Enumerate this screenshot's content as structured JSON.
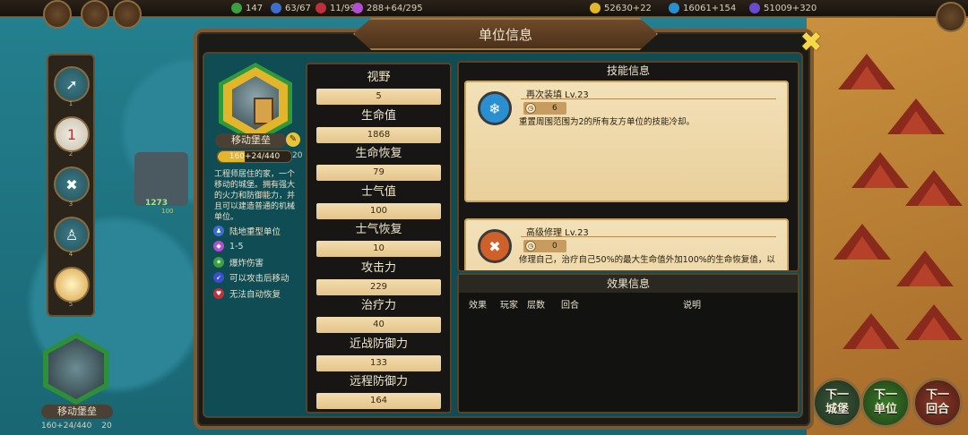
{
  "topbar": {
    "res1": "147",
    "res2": "63/67",
    "res3": "11/99",
    "res4": "288+64/295",
    "gold": "52630+22",
    "res6": "16061+154",
    "res7": "51009+320"
  },
  "leftstrip": {
    "numbers": [
      "1",
      "2",
      "3",
      "4",
      "5"
    ],
    "badge": "1"
  },
  "map": {
    "unit_hp": "1273",
    "unit_hp_sub": "100"
  },
  "bottom_unit": {
    "name": "移动堡垒",
    "hp": "160+24/440",
    "level": "20"
  },
  "nav": {
    "next_castle": "下一\n城堡",
    "next_unit": "下一\n单位",
    "next_turn": "下一\n回合"
  },
  "modal": {
    "title": "单位信息",
    "unit": {
      "name": "移动堡垒",
      "hp": "160+24/440",
      "hp_fraction": 0.36,
      "level": "20",
      "description": "工程师居住的家，一个移动的城堡。拥有强大的火力和防御能力，并且可以建造普通的机械单位。",
      "traits": [
        {
          "label": "陆地重型单位",
          "color": "#3a6fd0",
          "icon": "person-icon"
        },
        {
          "label": "1-5",
          "color": "#b04fd0",
          "icon": "range-diamond-icon"
        },
        {
          "label": "爆炸伤害",
          "color": "#3aa040",
          "icon": "explosion-icon"
        },
        {
          "label": "可以攻击后移动",
          "color": "#3a4fd0",
          "icon": "move-after-attack-icon"
        },
        {
          "label": "无法自动恢复",
          "color": "#c0303a",
          "icon": "no-heal-heart-icon"
        }
      ]
    },
    "stats": [
      {
        "label": "视野",
        "value": "5"
      },
      {
        "label": "生命值",
        "value": "1868"
      },
      {
        "label": "生命恢复",
        "value": "79"
      },
      {
        "label": "士气值",
        "value": "100"
      },
      {
        "label": "士气恢复",
        "value": "10"
      },
      {
        "label": "攻击力",
        "value": "229"
      },
      {
        "label": "治疗力",
        "value": "40"
      },
      {
        "label": "近战防御力",
        "value": "133"
      },
      {
        "label": "远程防御力",
        "value": "164"
      }
    ],
    "skills": {
      "header": "技能信息",
      "items": [
        {
          "name": "再次装填 Lv.23",
          "cooldown": "6",
          "description": "重置周围范围为2的所有友方单位的技能冷却。",
          "icon": "reload-icon",
          "icon_color": "#2a8fd0"
        },
        {
          "name": "高级修理 Lv.23",
          "cooldown": "0",
          "description": "修理自己，治疗自己50%的最大生命值外加100%的生命恢复值，以",
          "icon": "repair-tools-icon",
          "icon_color": "#d0602a"
        }
      ]
    },
    "effects": {
      "header": "效果信息",
      "columns": [
        "效果",
        "玩家",
        "层数",
        "回合",
        "说明"
      ]
    }
  }
}
